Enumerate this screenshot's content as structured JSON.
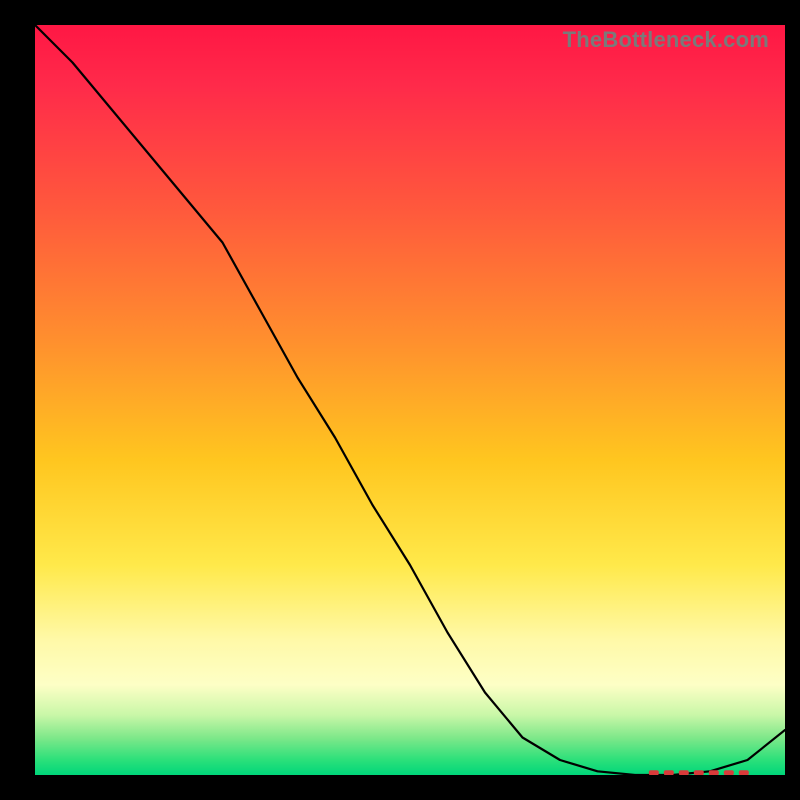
{
  "watermark": "TheBottleneck.com",
  "chart_data": {
    "type": "line",
    "title": "",
    "xlabel": "",
    "ylabel": "",
    "x": [
      0.0,
      0.05,
      0.1,
      0.15,
      0.2,
      0.25,
      0.3,
      0.35,
      0.4,
      0.45,
      0.5,
      0.55,
      0.6,
      0.65,
      0.7,
      0.75,
      0.8,
      0.85,
      0.9,
      0.95,
      1.0
    ],
    "values": [
      1.0,
      0.95,
      0.89,
      0.83,
      0.77,
      0.71,
      0.62,
      0.53,
      0.45,
      0.36,
      0.28,
      0.19,
      0.11,
      0.05,
      0.02,
      0.005,
      0.0,
      0.0,
      0.005,
      0.02,
      0.06
    ],
    "xlim": [
      0,
      1
    ],
    "ylim": [
      0,
      1
    ],
    "background_gradient": {
      "stops": [
        {
          "pos": 0.0,
          "color": "#ff1744"
        },
        {
          "pos": 0.25,
          "color": "#ff5a3c"
        },
        {
          "pos": 0.5,
          "color": "#ffc61f"
        },
        {
          "pos": 0.75,
          "color": "#fff9a8"
        },
        {
          "pos": 0.95,
          "color": "#7fe88a"
        },
        {
          "pos": 1.0,
          "color": "#00d67a"
        }
      ]
    },
    "markers": {
      "x": [
        0.825,
        0.845,
        0.865,
        0.885,
        0.905,
        0.925,
        0.945
      ],
      "y": [
        0.003,
        0.003,
        0.003,
        0.003,
        0.003,
        0.003,
        0.003
      ],
      "color": "#d93a3a"
    }
  }
}
